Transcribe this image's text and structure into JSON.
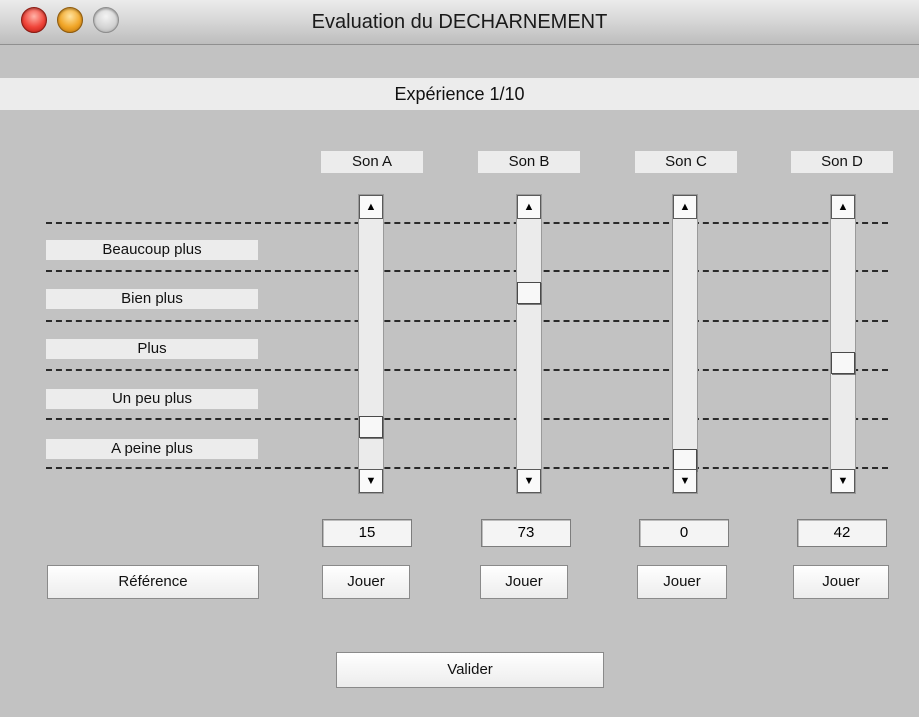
{
  "window": {
    "title": "Evaluation du DECHARNEMENT"
  },
  "banner": {
    "text": "Expérience 1/10"
  },
  "levels": [
    "Beaucoup plus",
    "Bien plus",
    "Plus",
    "Un peu plus",
    "A peine plus"
  ],
  "sounds": [
    {
      "label": "Son A",
      "value": "15",
      "play_label": "Jouer"
    },
    {
      "label": "Son B",
      "value": "73",
      "play_label": "Jouer"
    },
    {
      "label": "Son C",
      "value": "0",
      "play_label": "Jouer"
    },
    {
      "label": "Son D",
      "value": "42",
      "play_label": "Jouer"
    }
  ],
  "reference_button": "Référence",
  "validate_button": "Valider",
  "icons": {
    "up": "▲",
    "down": "▼"
  }
}
